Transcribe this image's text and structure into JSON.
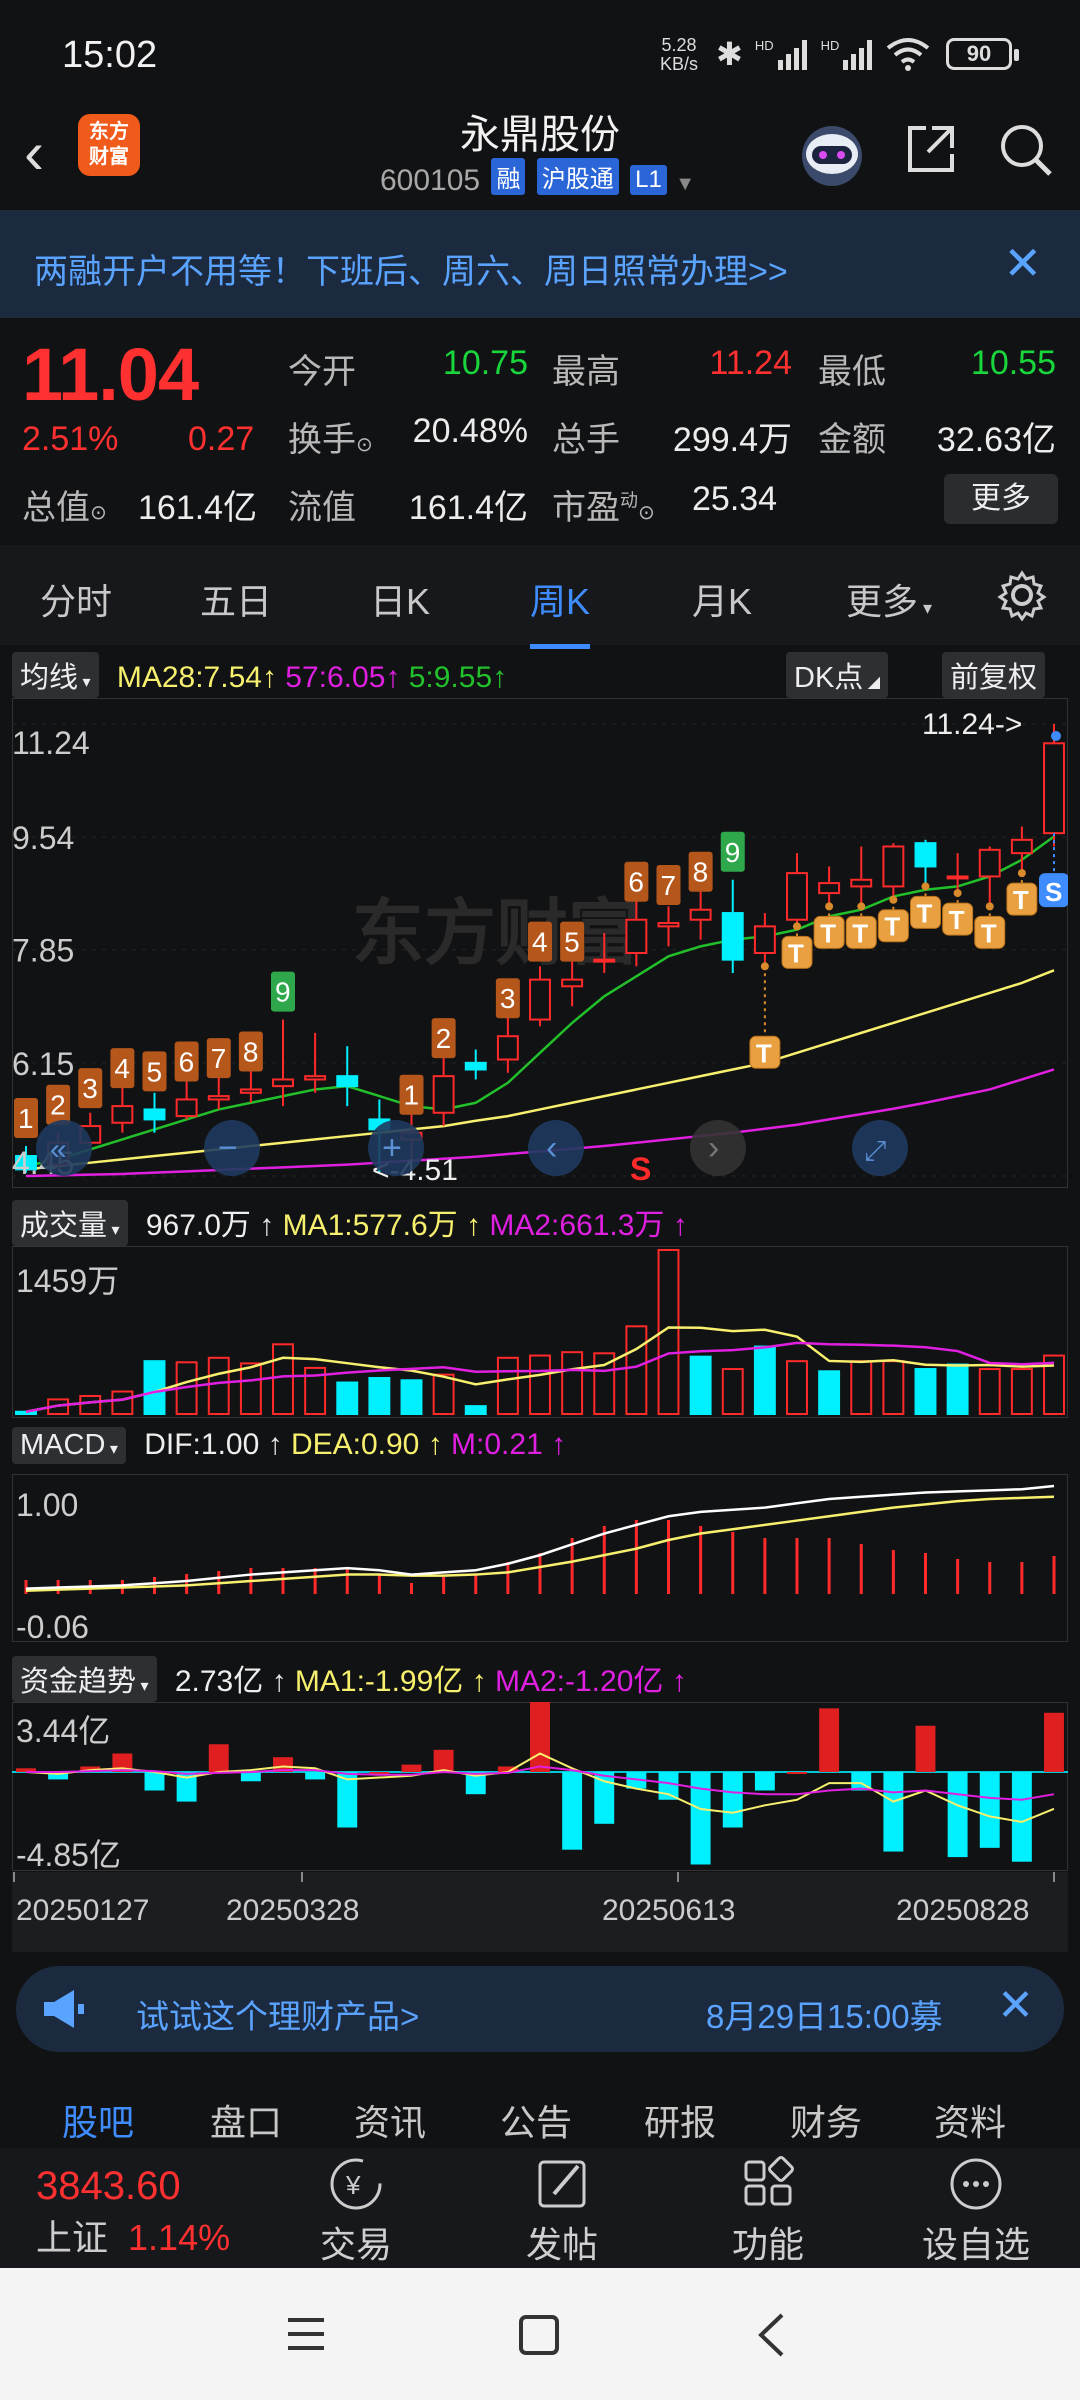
{
  "status": {
    "time": "15:02",
    "net_speed": "5.28",
    "net_unit": "KB/s",
    "battery": "90",
    "hd1": "HD",
    "hd2": "HD"
  },
  "header": {
    "logo_top": "东方",
    "logo_bottom": "财富",
    "title": "永鼎股份",
    "code": "600105",
    "tag_margin": "融",
    "tag_connect": "沪股通",
    "tag_level": "L1"
  },
  "banner": {
    "text": "两融开户不用等！下班后、周六、周日照常办理>>"
  },
  "quote": {
    "price": "11.04",
    "change_pct": "2.51%",
    "change": "0.27",
    "open_label": "今开",
    "open": "10.75",
    "high_label": "最高",
    "high": "11.24",
    "low_label": "最低",
    "low": "10.55",
    "turnover_label": "换手",
    "turnover": "20.48%",
    "volume_label": "总手",
    "volume": "299.4万",
    "amount_label": "金额",
    "amount": "32.63亿",
    "mktcap_label": "总值",
    "mktcap": "161.4亿",
    "float_label": "流值",
    "float": "161.4亿",
    "pe_label": "市盈",
    "pe_sup": "动",
    "pe": "25.34",
    "more": "更多"
  },
  "tabs": [
    "分时",
    "五日",
    "日K",
    "周K",
    "月K",
    "更多"
  ],
  "ma_row": {
    "selector": "均线",
    "ma28": "MA28:7.54",
    "ma57": "57:6.05",
    "ma5": "5:9.55",
    "dk": "DK点",
    "adjust": "前复权"
  },
  "volume_row": {
    "selector": "成交量",
    "value": "967.0万",
    "ma1": "MA1:577.6万",
    "ma2": "MA2:661.3万",
    "axis_top": "1459万"
  },
  "macd_row": {
    "selector": "MACD",
    "dif": "DIF:1.00",
    "dea": "DEA:0.90",
    "m": "M:0.21",
    "axis_top": "1.00",
    "axis_bottom": "-0.06"
  },
  "fund_row": {
    "selector": "资金趋势",
    "value": "2.73亿",
    "ma1": "MA1:-1.99亿",
    "ma2": "MA2:-1.20亿",
    "axis_top": "3.44亿",
    "axis_bottom": "-4.85亿"
  },
  "dates": [
    "20250127",
    "20250328",
    "20250613",
    "20250828"
  ],
  "chart_data": {
    "type": "candlestick",
    "y_ticks": [
      "11.24",
      "9.54",
      "7.85",
      "6.15",
      "4.45"
    ],
    "ylim": [
      4.45,
      11.24
    ],
    "max_label": "11.24->",
    "min_label": "<-4.51",
    "sell_label": "S",
    "signal_s": "S",
    "signal_t": "T",
    "watermark": "东方财富",
    "candles": [
      {
        "o": 4.75,
        "c": 4.55,
        "h": 4.9,
        "l": 4.5
      },
      {
        "o": 4.62,
        "c": 4.95,
        "h": 5.1,
        "l": 4.55
      },
      {
        "o": 4.95,
        "c": 5.2,
        "h": 5.4,
        "l": 4.9
      },
      {
        "o": 5.25,
        "c": 5.5,
        "h": 5.8,
        "l": 5.1
      },
      {
        "o": 5.45,
        "c": 5.3,
        "h": 5.7,
        "l": 5.1
      },
      {
        "o": 5.35,
        "c": 5.6,
        "h": 5.9,
        "l": 5.3
      },
      {
        "o": 5.6,
        "c": 5.65,
        "h": 6.0,
        "l": 5.45
      },
      {
        "o": 5.7,
        "c": 5.75,
        "h": 6.2,
        "l": 5.55
      },
      {
        "o": 5.8,
        "c": 5.9,
        "h": 6.8,
        "l": 5.5
      },
      {
        "o": 5.9,
        "c": 5.95,
        "h": 6.6,
        "l": 5.7
      },
      {
        "o": 5.95,
        "c": 5.8,
        "h": 6.4,
        "l": 5.5
      },
      {
        "o": 5.3,
        "c": 5.15,
        "h": 5.6,
        "l": 4.51
      },
      {
        "o": 5.0,
        "c": 5.1,
        "h": 5.5,
        "l": 4.51
      },
      {
        "o": 5.4,
        "c": 5.95,
        "h": 6.3,
        "l": 5.2
      },
      {
        "o": 6.15,
        "c": 6.05,
        "h": 6.35,
        "l": 5.9
      },
      {
        "o": 6.2,
        "c": 6.55,
        "h": 6.9,
        "l": 6.0
      },
      {
        "o": 6.8,
        "c": 7.4,
        "h": 7.6,
        "l": 6.7
      },
      {
        "o": 7.3,
        "c": 7.4,
        "h": 7.7,
        "l": 7.0
      },
      {
        "o": 7.7,
        "c": 7.7,
        "h": 8.1,
        "l": 7.5
      },
      {
        "o": 7.8,
        "c": 8.3,
        "h": 8.7,
        "l": 7.6
      },
      {
        "o": 8.2,
        "c": 8.25,
        "h": 8.5,
        "l": 7.9
      },
      {
        "o": 8.3,
        "c": 8.45,
        "h": 8.9,
        "l": 8.0
      },
      {
        "o": 8.4,
        "c": 7.7,
        "h": 8.9,
        "l": 7.5
      },
      {
        "o": 7.8,
        "c": 8.2,
        "h": 8.4,
        "l": 7.6
      },
      {
        "o": 8.3,
        "c": 9.0,
        "h": 9.3,
        "l": 8.2
      },
      {
        "o": 8.7,
        "c": 8.85,
        "h": 9.1,
        "l": 8.5
      },
      {
        "o": 8.8,
        "c": 8.9,
        "h": 9.4,
        "l": 8.5
      },
      {
        "o": 8.8,
        "c": 9.4,
        "h": 9.45,
        "l": 8.6
      },
      {
        "o": 9.45,
        "c": 9.1,
        "h": 9.5,
        "l": 8.8
      },
      {
        "o": 8.95,
        "c": 8.95,
        "h": 9.3,
        "l": 8.7
      },
      {
        "o": 8.95,
        "c": 9.35,
        "h": 9.4,
        "l": 8.5
      },
      {
        "o": 9.3,
        "c": 9.5,
        "h": 9.7,
        "l": 9.0
      },
      {
        "o": 9.6,
        "c": 10.95,
        "h": 11.24,
        "l": 9.4
      }
    ],
    "ma5": [
      4.6,
      4.7,
      4.85,
      5.0,
      5.15,
      5.3,
      5.45,
      5.55,
      5.65,
      5.75,
      5.8,
      5.65,
      5.5,
      5.45,
      5.55,
      5.85,
      6.3,
      6.75,
      7.15,
      7.45,
      7.75,
      7.9,
      8.0,
      8.05,
      8.15,
      8.35,
      8.45,
      8.65,
      8.75,
      8.8,
      8.95,
      9.2,
      9.55
    ],
    "ma28": [
      4.55,
      4.6,
      4.65,
      4.7,
      4.75,
      4.8,
      4.85,
      4.9,
      4.95,
      5.0,
      5.05,
      5.1,
      5.15,
      5.2,
      5.28,
      5.35,
      5.45,
      5.55,
      5.65,
      5.75,
      5.85,
      5.95,
      6.05,
      6.15,
      6.3,
      6.45,
      6.6,
      6.75,
      6.9,
      7.05,
      7.2,
      7.35,
      7.54
    ],
    "ma57": [
      4.45,
      4.46,
      4.47,
      4.48,
      4.5,
      4.52,
      4.54,
      4.56,
      4.58,
      4.6,
      4.62,
      4.65,
      4.68,
      4.71,
      4.74,
      4.78,
      4.82,
      4.86,
      4.9,
      4.95,
      5.0,
      5.05,
      5.1,
      5.16,
      5.22,
      5.3,
      5.38,
      5.46,
      5.55,
      5.65,
      5.75,
      5.9,
      6.05
    ],
    "td_labels": [
      {
        "i": 0,
        "n": "1"
      },
      {
        "i": 1,
        "n": "2"
      },
      {
        "i": 2,
        "n": "3"
      },
      {
        "i": 3,
        "n": "4"
      },
      {
        "i": 4,
        "n": "5"
      },
      {
        "i": 5,
        "n": "6"
      },
      {
        "i": 6,
        "n": "7"
      },
      {
        "i": 7,
        "n": "8"
      },
      {
        "i": 8,
        "n": "9"
      },
      {
        "i": 12,
        "n": "1"
      },
      {
        "i": 13,
        "n": "2"
      },
      {
        "i": 15,
        "n": "3"
      },
      {
        "i": 16,
        "n": "4"
      },
      {
        "i": 17,
        "n": "5"
      },
      {
        "i": 19,
        "n": "6"
      },
      {
        "i": 20,
        "n": "7"
      },
      {
        "i": 21,
        "n": "8"
      },
      {
        "i": 22,
        "n": "9"
      }
    ],
    "t_signals": [
      23,
      24,
      25,
      26,
      27,
      28,
      29,
      30,
      31
    ],
    "volume": [
      20,
      130,
      160,
      200,
      470,
      460,
      500,
      450,
      620,
      410,
      280,
      320,
      300,
      350,
      70,
      500,
      520,
      550,
      540,
      780,
      1459,
      510,
      400,
      600,
      470,
      380,
      470,
      470,
      400,
      440,
      400,
      400,
      520
    ],
    "volume_up": [
      false,
      true,
      true,
      true,
      false,
      true,
      true,
      true,
      true,
      true,
      false,
      false,
      false,
      true,
      false,
      true,
      true,
      true,
      true,
      true,
      true,
      false,
      true,
      false,
      true,
      false,
      true,
      true,
      false,
      false,
      true,
      true,
      true
    ],
    "macd_dif": [
      0.05,
      0.06,
      0.07,
      0.08,
      0.1,
      0.12,
      0.15,
      0.18,
      0.2,
      0.22,
      0.24,
      0.22,
      0.18,
      0.2,
      0.22,
      0.28,
      0.36,
      0.46,
      0.56,
      0.64,
      0.72,
      0.76,
      0.78,
      0.8,
      0.84,
      0.88,
      0.9,
      0.92,
      0.94,
      0.95,
      0.96,
      0.97,
      1.0
    ],
    "macd_dea": [
      0.03,
      0.04,
      0.05,
      0.06,
      0.07,
      0.08,
      0.1,
      0.12,
      0.14,
      0.16,
      0.18,
      0.18,
      0.17,
      0.17,
      0.18,
      0.2,
      0.25,
      0.3,
      0.36,
      0.42,
      0.5,
      0.56,
      0.6,
      0.64,
      0.68,
      0.72,
      0.76,
      0.8,
      0.83,
      0.86,
      0.88,
      0.89,
      0.9
    ],
    "fund": [
      0.2,
      -0.4,
      0.3,
      1.0,
      -1.0,
      -1.6,
      1.5,
      -0.5,
      0.8,
      -0.4,
      -3.0,
      0.0,
      0.4,
      1.2,
      -1.2,
      0.3,
      4.5,
      -4.2,
      -2.8,
      -0.9,
      -1.5,
      -5.0,
      -3.0,
      -1.0,
      0.0,
      3.44,
      -1.0,
      -4.3,
      2.5,
      -4.6,
      -4.1,
      -4.85,
      3.2
    ],
    "fund_ma1": [
      0.0,
      -0.1,
      0.1,
      0.2,
      0.0,
      -0.3,
      0.0,
      0.1,
      0.3,
      0.2,
      -0.4,
      -0.3,
      -0.2,
      0.1,
      -0.2,
      0.0,
      1.0,
      0.2,
      -0.5,
      -0.9,
      -1.2,
      -2.0,
      -2.2,
      -1.8,
      -1.5,
      -0.6,
      -0.6,
      -1.6,
      -1.0,
      -1.8,
      -2.4,
      -2.7,
      -1.99
    ],
    "fund_ma2": [
      0.0,
      0.0,
      0.05,
      0.1,
      0.05,
      -0.1,
      -0.05,
      0.0,
      0.1,
      0.1,
      -0.1,
      -0.15,
      -0.15,
      0.0,
      -0.1,
      -0.05,
      0.3,
      0.1,
      -0.2,
      -0.4,
      -0.6,
      -0.9,
      -1.1,
      -1.2,
      -1.2,
      -1.0,
      -0.9,
      -1.1,
      -1.0,
      -1.2,
      -1.4,
      -1.5,
      -1.2
    ]
  },
  "ad": {
    "text": "试试这个理财产品>",
    "time": "8月29日15:00募"
  },
  "subtabs": [
    "股吧",
    "盘口",
    "资讯",
    "公告",
    "研报",
    "财务",
    "资料"
  ],
  "toolbar": {
    "index_value": "3843.60",
    "index_name": "上证",
    "index_pct": "1.14%",
    "trade": "交易",
    "post": "发帖",
    "func": "功能",
    "watch": "设自选",
    "trade_sym": "¥"
  },
  "colors": {
    "up": "#ff2a2a",
    "down": "#00f0ff",
    "ma5": "#22c02a",
    "ma28": "#f7ef6e",
    "ma57": "#e020e0",
    "accent": "#3f8cff"
  }
}
